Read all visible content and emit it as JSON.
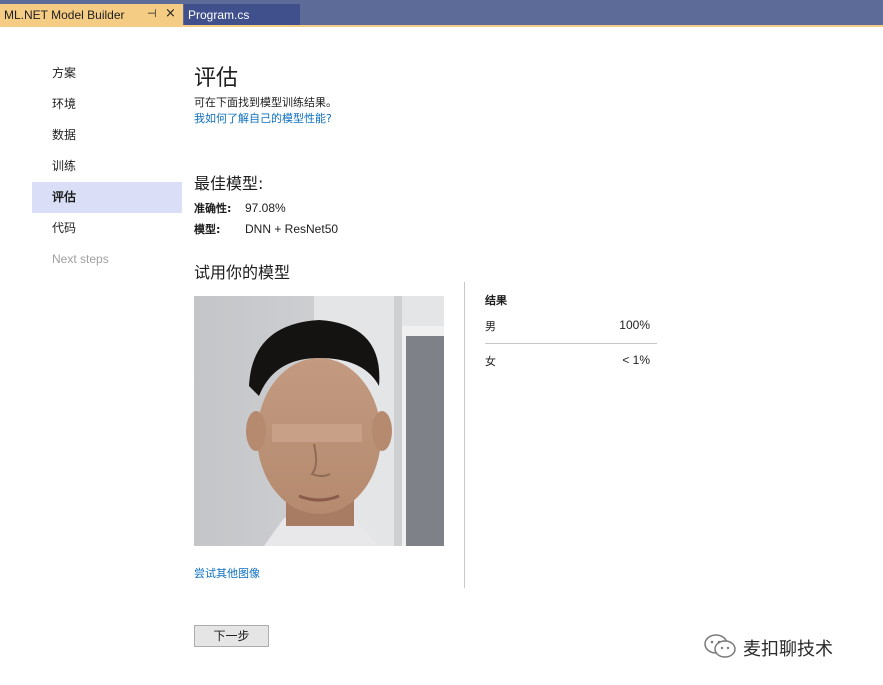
{
  "tabs": {
    "active_label": "ML.NET Model Builder",
    "pin_glyph": "⊣",
    "close_glyph": "×",
    "second_label": "Program.cs"
  },
  "nav": {
    "items": [
      {
        "label": "方案",
        "state": "normal"
      },
      {
        "label": "环境",
        "state": "normal"
      },
      {
        "label": "数据",
        "state": "normal"
      },
      {
        "label": "训练",
        "state": "normal"
      },
      {
        "label": "评估",
        "state": "active"
      },
      {
        "label": "代码",
        "state": "normal"
      },
      {
        "label": "Next steps",
        "state": "disabled"
      }
    ]
  },
  "main": {
    "title": "评估",
    "subtitle": "可在下面找到模型训练结果。",
    "help_link": "我如何了解自己的模型性能?",
    "best_model_heading": "最佳模型:",
    "accuracy_label": "准确性:",
    "accuracy_value": "97.08%",
    "model_label": "模型:",
    "model_value": "DNN + ResNet50",
    "try_heading": "试用你的模型",
    "try_other_link": "尝试其他图像",
    "next_button": "下一步"
  },
  "results": {
    "title": "结果",
    "rows": [
      {
        "label": "男",
        "value": "100%"
      },
      {
        "label": "女",
        "value": "< 1%"
      }
    ]
  },
  "watermark": {
    "text": "麦扣聊技术"
  },
  "colors": {
    "tabbar": "#5d6b99",
    "active_tab": "#f5cc84",
    "nav_active": "#dadff7",
    "link": "#0e70c0"
  }
}
